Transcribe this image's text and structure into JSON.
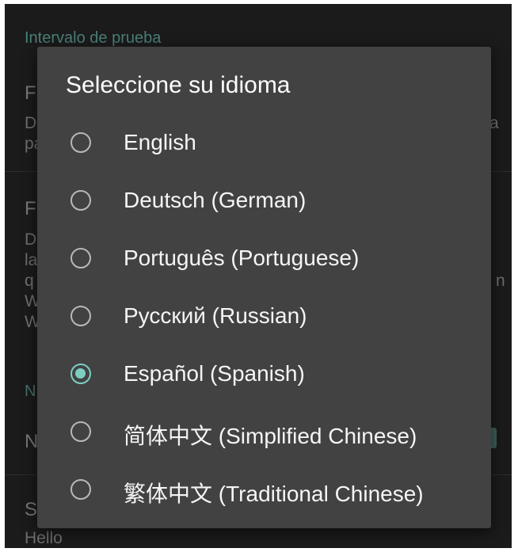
{
  "background": {
    "section_header": "Intervalo de prueba",
    "row1": {
      "title": "F",
      "line1": "D",
      "line1_tail": "a",
      "line2": "pa"
    },
    "row2": {
      "title": "F",
      "line1": "D",
      "line2": "la",
      "line3": "q",
      "line3_tail": "n",
      "line4": "W",
      "line5": "W"
    },
    "section_header2": "N",
    "row3": {
      "title": "N"
    },
    "row4": {
      "title": "S",
      "subtitle": "Hello"
    }
  },
  "dialog": {
    "title": "Seleccione su idioma",
    "selected_index": 4,
    "options": [
      {
        "label": "English",
        "checked": false
      },
      {
        "label": "Deutsch (German)",
        "checked": false
      },
      {
        "label": "Português (Portuguese)",
        "checked": false
      },
      {
        "label": "Русский (Russian)",
        "checked": false
      },
      {
        "label": "Español (Spanish)",
        "checked": true
      },
      {
        "label": "简体中文 (Simplified Chinese)",
        "checked": false
      },
      {
        "label": "繁体中文 (Traditional Chinese)",
        "checked": false
      }
    ]
  },
  "colors": {
    "accent": "#7dcdc2",
    "dialog_bg": "#424242",
    "screen_bg": "#1b1b1b"
  }
}
